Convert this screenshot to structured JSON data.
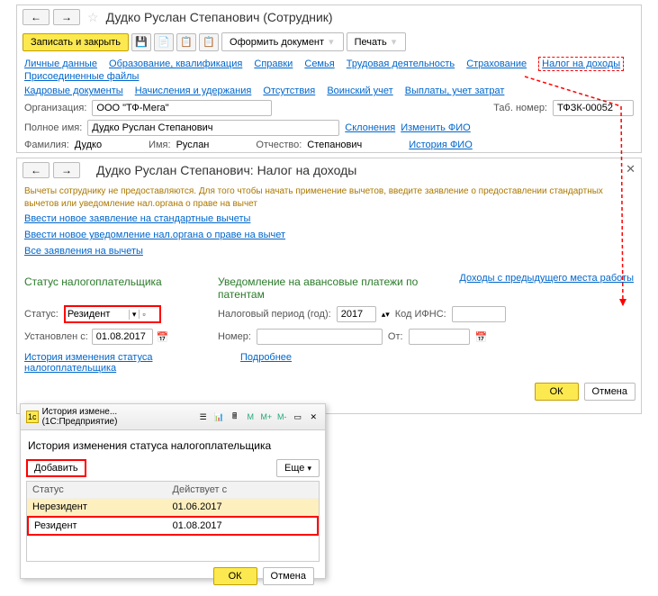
{
  "w1": {
    "title": "Дудко Руслан Степанович (Сотрудник)",
    "save_close": "Записать и закрыть",
    "doc_btn": "Оформить документ",
    "print_btn": "Печать",
    "tabs": [
      "Личные данные",
      "Образование, квалификация",
      "Справки",
      "Семья",
      "Трудовая деятельность",
      "Страхование",
      "Налог на доходы",
      "Присоединенные файлы"
    ],
    "tabs2": [
      "Кадровые документы",
      "Начисления и удержания",
      "Отсутствия",
      "Воинский учет",
      "Выплаты, учет затрат"
    ],
    "org_label": "Организация:",
    "org_value": "ООО \"ТФ-Мега\"",
    "tab_num_label": "Таб. номер:",
    "tab_num_value": "ТФЗК-00052",
    "full_label": "Полное имя:",
    "full_value": "Дудко Руслан Степанович",
    "decl": "Склонения",
    "fio_edit": "Изменить ФИО",
    "surname_l": "Фамилия:",
    "surname_v": "Дудко",
    "name_l": "Имя:",
    "name_v": "Руслан",
    "patro_l": "Отчество:",
    "patro_v": "Степанович",
    "fio_hist": "История ФИО"
  },
  "w2": {
    "title": "Дудко Руслан Степанович: Налог на доходы",
    "info": "Вычеты сотруднику не предоставляются. Для того чтобы начать применение вычетов, введите заявление о предоставлении стандартных вычетов или уведомление нал.органа о праве на вычет",
    "link1": "Ввести новое заявление на стандартные вычеты",
    "link2": "Ввести новое уведомление нал.органа о праве на вычет",
    "link3": "Все заявления на вычеты",
    "hdr_status": "Статус налогоплательщика",
    "hdr_notify": "Уведомление на авансовые платежи по патентам",
    "link_income": "Доходы с предыдущего места работы",
    "status_l": "Статус:",
    "status_v": "Резидент",
    "period_l": "Налоговый период (год):",
    "period_v": "2017",
    "ifns_l": "Код ИФНС:",
    "set_l": "Установлен с:",
    "set_v": "01.08.2017",
    "num_l": "Номер:",
    "from_l": "От:",
    "hist_link": "История изменения статуса налогоплательщика",
    "more_link": "Подробнее",
    "ok": "ОК",
    "cancel": "Отмена"
  },
  "w3": {
    "tb_title": "История измене... (1С:Предприятие)",
    "title": "История изменения статуса налогоплательщика",
    "add": "Добавить",
    "more": "Еще",
    "col1": "Статус",
    "col2": "Действует с",
    "rows": [
      {
        "status": "Нерезидент",
        "date": "01.06.2017"
      },
      {
        "status": "Резидент",
        "date": "01.08.2017"
      }
    ],
    "ok": "ОК",
    "cancel": "Отмена"
  }
}
